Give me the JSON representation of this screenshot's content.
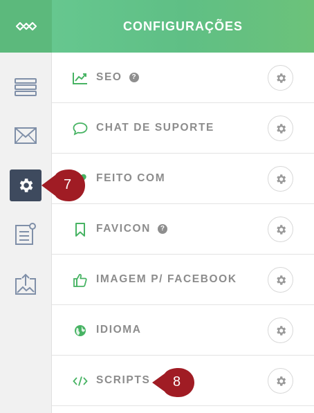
{
  "header": {
    "title": "CONFIGURAÇÕES"
  },
  "sidebar": {
    "items": [
      {
        "icon": "list-icon"
      },
      {
        "icon": "mail-icon"
      },
      {
        "icon": "gear-icon",
        "active": true
      },
      {
        "icon": "document-icon"
      },
      {
        "icon": "image-upload-icon"
      }
    ]
  },
  "settings": [
    {
      "label": "SEO",
      "icon": "trend-chart-icon",
      "help": "?"
    },
    {
      "label": "CHAT DE SUPORTE",
      "icon": "chat-bubble-icon"
    },
    {
      "label": "FEITO COM",
      "icon": "heart-icon"
    },
    {
      "label": "FAVICON",
      "icon": "bookmark-icon",
      "help": "?"
    },
    {
      "label": "IMAGEM P/ FACEBOOK",
      "icon": "thumbs-up-icon"
    },
    {
      "label": "IDIOMA",
      "icon": "globe-icon"
    },
    {
      "label": "SCRIPTS",
      "icon": "code-icon"
    }
  ],
  "callouts": [
    {
      "number": "7"
    },
    {
      "number": "8"
    }
  ],
  "colors": {
    "accent_green": "#5cb97c",
    "sidebar_active": "#3e4a5e",
    "callout_red": "#a01c24",
    "label_gray": "#8c8c8c"
  }
}
